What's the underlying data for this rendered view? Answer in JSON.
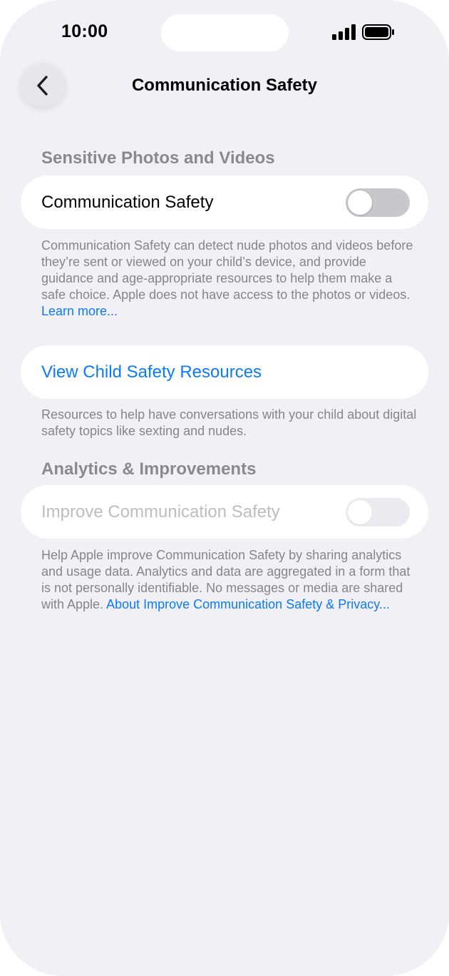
{
  "status_bar": {
    "time": "10:00",
    "icons": [
      "signal-icon",
      "battery-icon"
    ]
  },
  "nav": {
    "back_icon": "chevron-left-icon",
    "title": "Communication Safety"
  },
  "sections": {
    "sensitive": {
      "header": "Sensitive Photos and Videos",
      "toggle_label": "Communication Safety",
      "toggle_on": false,
      "description": "Communication Safety can detect nude photos and videos before they’re sent or viewed on your child’s device, and provide guidance and age-appropriate resources to help them make a safe choice. Apple does not have access to the photos or videos.",
      "description_link": "Learn more..."
    },
    "resources": {
      "link_label": "View Child Safety Resources",
      "description": "Resources to help have conversations with your child about digital safety topics like sexting and nudes."
    },
    "analytics": {
      "header": "Analytics & Improvements",
      "toggle_label": "Improve Communication Safety",
      "toggle_on": false,
      "toggle_enabled": false,
      "description": "Help Apple improve Communication Safety by sharing analytics and usage data. Analytics and data are aggregated in a form that is not personally identifiable. No messages or media are shared with Apple.",
      "description_link": "About Improve Communication Safety & Privacy..."
    }
  },
  "colors": {
    "background": "#f0f0f5",
    "card": "#ffffff",
    "link": "#0a7aff",
    "secondary_text": "#85858a",
    "toggle_off": "#c7c7cc"
  }
}
